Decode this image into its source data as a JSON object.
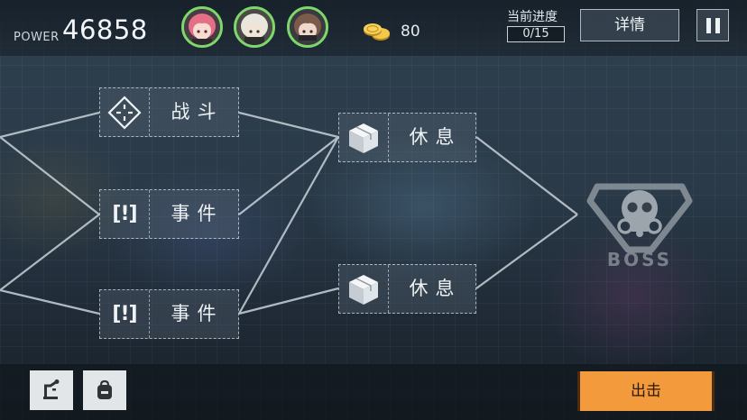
{
  "header": {
    "power_label": "POWER",
    "power_value": "46858",
    "squad": [
      {
        "name": "pink-hair-member-portrait",
        "hair_color": "#e56f86"
      },
      {
        "name": "white-hair-member-portrait",
        "hair_color": "#e9e6de"
      },
      {
        "name": "brown-hair-member-portrait",
        "hair_color": "#7a5b4c"
      }
    ],
    "coin_icon": "gold-coins-icon",
    "coins": "80",
    "progress_label": "当前进度",
    "progress_value": "0/15",
    "details_label": "详情",
    "pause_icon": "pause-icon"
  },
  "map": {
    "nodes": [
      {
        "id": "battle",
        "icon": "crosshair-icon",
        "label": "战斗"
      },
      {
        "id": "event-1",
        "icon": "event-bracket-icon",
        "icon_text": "[!]",
        "label": "事件"
      },
      {
        "id": "event-2",
        "icon": "event-bracket-icon",
        "icon_text": "[!]",
        "label": "事件"
      },
      {
        "id": "rest-1",
        "icon": "crate-icon",
        "label": "休息"
      },
      {
        "id": "rest-2",
        "icon": "crate-icon",
        "label": "休息"
      }
    ],
    "boss": {
      "icon": "boss-skull-icon",
      "label": "BOSS"
    }
  },
  "footer": {
    "build_icon": "crane-icon",
    "bag_icon": "backpack-icon",
    "sortie_label": "出击"
  },
  "colors": {
    "accent_orange": "#f39a3c",
    "squad_ring": "#7dd86a",
    "path_line": "#c9d2da"
  }
}
